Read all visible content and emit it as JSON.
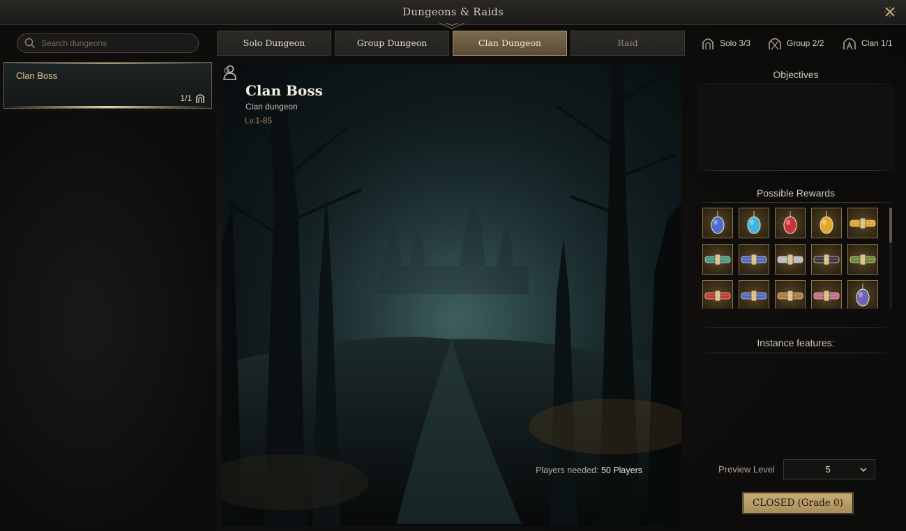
{
  "window": {
    "title": "Dungeons & Raids"
  },
  "search": {
    "placeholder": "Search dungeons",
    "value": ""
  },
  "dungeon_list": [
    {
      "name": "Clan Boss",
      "count": "1/1",
      "icon": "clan-icon",
      "selected": true
    }
  ],
  "tabs": [
    {
      "label": "Solo Dungeon",
      "active": false
    },
    {
      "label": "Group Dungeon",
      "active": false
    },
    {
      "label": "Clan Dungeon",
      "active": true
    },
    {
      "label": "Raid",
      "active": false
    }
  ],
  "counters": [
    {
      "label": "Solo 3/3",
      "icon": "solo-icon"
    },
    {
      "label": "Group 2/2",
      "icon": "group-icon"
    },
    {
      "label": "Clan 1/1",
      "icon": "clan-icon"
    }
  ],
  "dungeon": {
    "title": "Clan Boss",
    "type": "Clan dungeon",
    "level": "Lv.1-85",
    "players_label": "Players needed:",
    "players_value": "50 Players"
  },
  "sections": {
    "objectives": "Objectives",
    "rewards": "Possible Rewards",
    "features": "Instance features:"
  },
  "rewards": [
    "amulet-blue",
    "amulet-cyan",
    "amulet-red",
    "amulet-gold",
    "belt-gold",
    "belt-teal",
    "belt-blue",
    "belt-silver",
    "belt-dark",
    "belt-green",
    "belt-red",
    "belt-blue",
    "belt-bronze",
    "belt-pink",
    "amulet-violet"
  ],
  "colors": {
    "accent": "#c8ae7a",
    "tab_active": "#7a6a4d",
    "selected_name": "#e6c98f",
    "level": "#a48e63"
  },
  "preview": {
    "label": "Preview Level",
    "value": "5"
  },
  "status_button": {
    "label": "CLOSED (Grade 0)"
  }
}
